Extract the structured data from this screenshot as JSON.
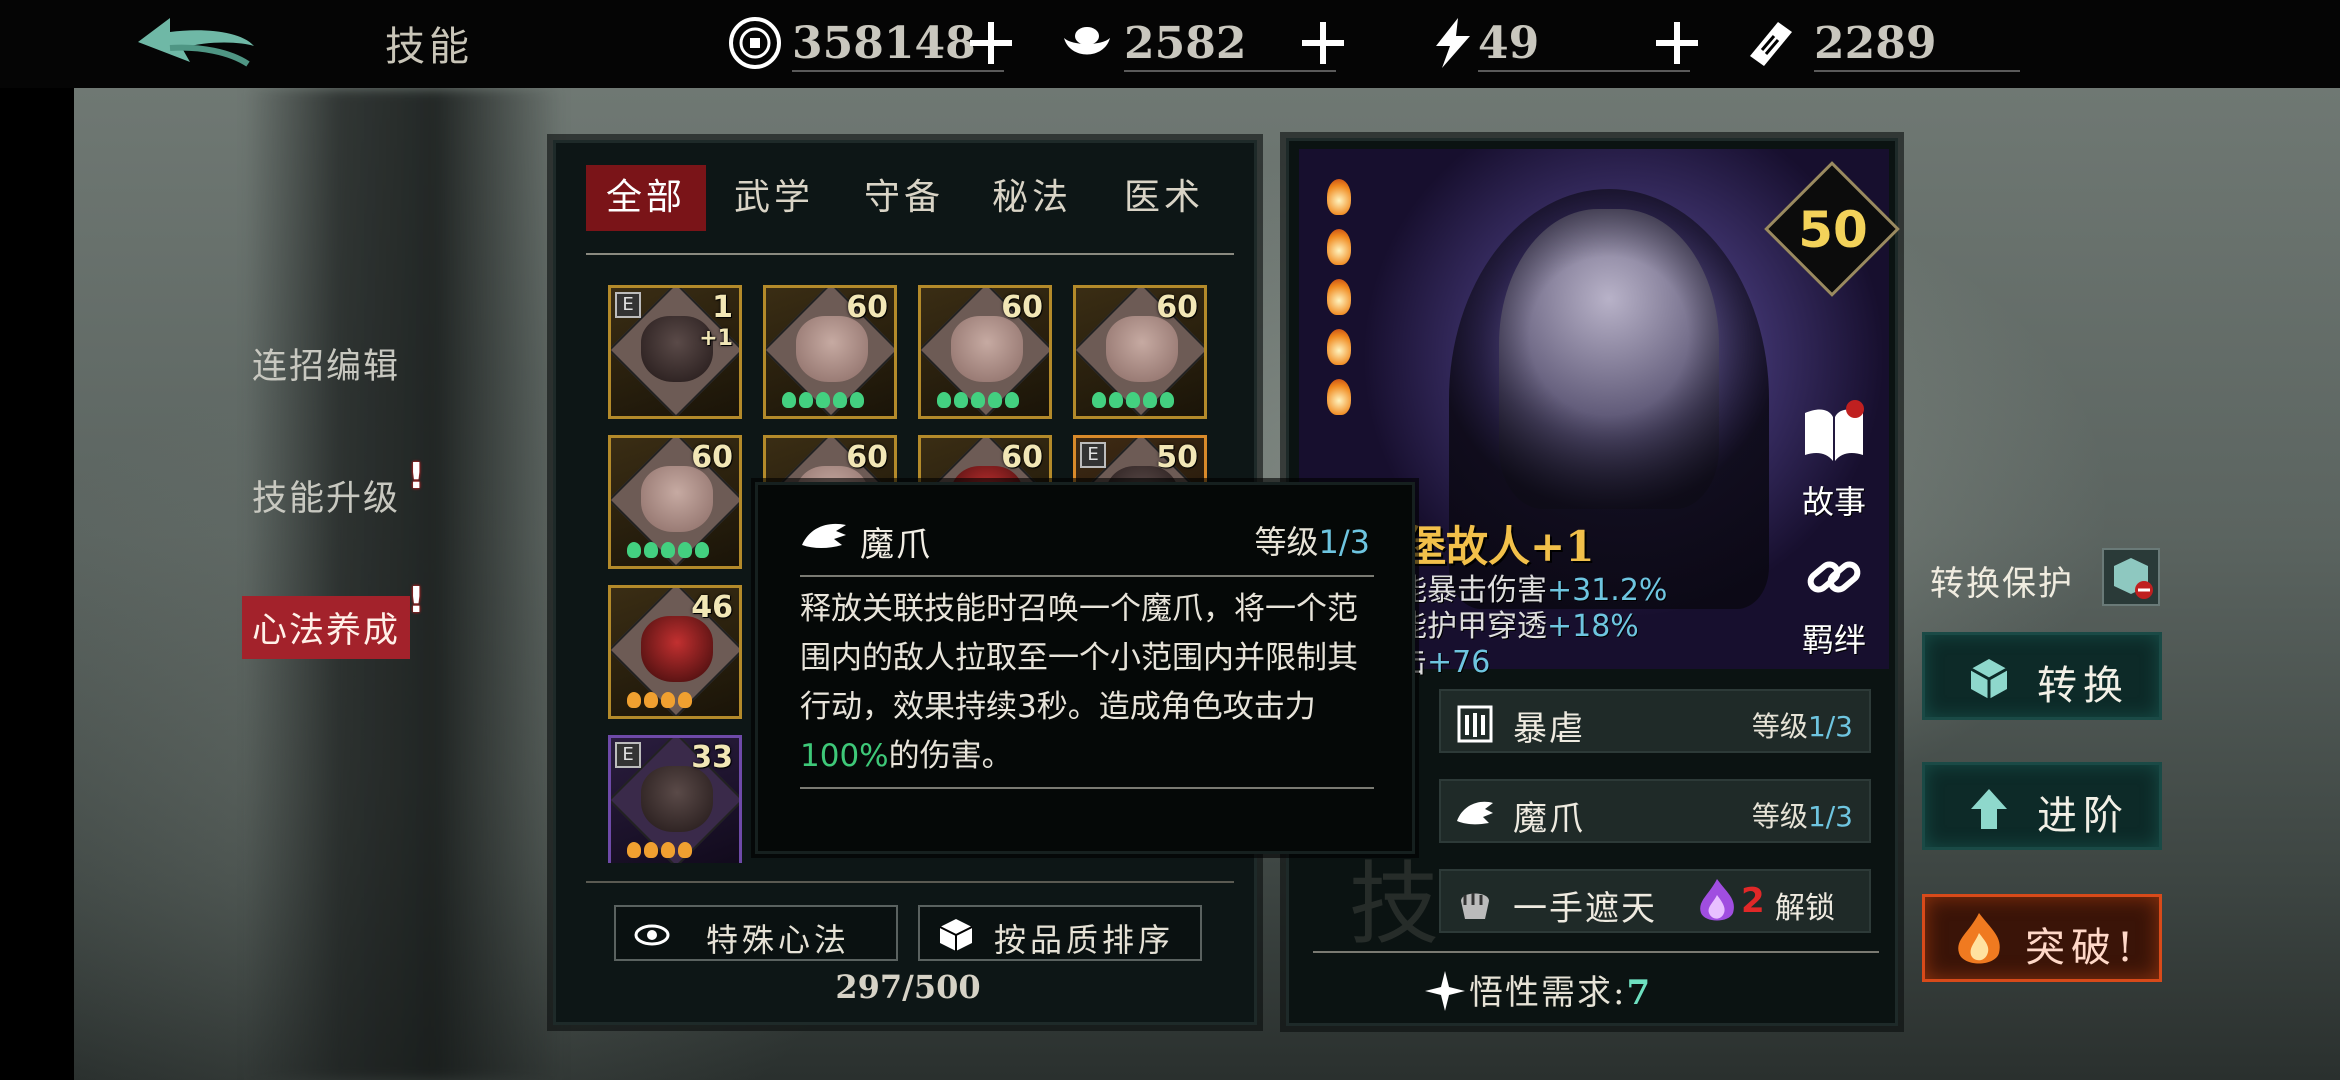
{
  "header": {
    "title": "技能",
    "currencies": [
      {
        "name": "coin-icon",
        "value": "358148"
      },
      {
        "name": "silver-ingot-icon",
        "value": "2582"
      },
      {
        "name": "lightning-icon",
        "value": "49"
      },
      {
        "name": "ticket-icon",
        "value": "2289"
      }
    ]
  },
  "left_menu": {
    "items": [
      {
        "label": "连招编辑"
      },
      {
        "label": "技能升级"
      },
      {
        "label": "心法养成"
      }
    ]
  },
  "tabs": [
    "全部",
    "武学",
    "守备",
    "秘法",
    "医术"
  ],
  "cards": [
    {
      "level": "1",
      "sub": "+1",
      "e": "E"
    },
    {
      "level": "60"
    },
    {
      "level": "60"
    },
    {
      "level": "60"
    },
    {
      "level": "60"
    },
    {
      "level": "60"
    },
    {
      "level": "60"
    },
    {
      "level": "50",
      "e": "E"
    },
    {
      "level": "46"
    },
    {
      "level": "33",
      "e": "E"
    }
  ],
  "mid_buttons": {
    "special": "特殊心法",
    "sort": "按品质排序"
  },
  "count": "297/500",
  "detail": {
    "level": "50",
    "name": "堡故人+1",
    "stats": [
      {
        "label": "能暴击伤害",
        "value": "+31.2%"
      },
      {
        "label": "能护甲穿透",
        "value": "+18%"
      },
      {
        "label": "击",
        "value": "+76"
      }
    ],
    "story_label": "故事",
    "bond_label": "羁绊",
    "skills": [
      {
        "name": "暴虐",
        "level_label": "等级",
        "level": "1/3"
      },
      {
        "name": "魔爪",
        "level_label": "等级",
        "level": "1/3"
      },
      {
        "name": "一手遮天",
        "unlock_count": "2",
        "unlock_label": "解锁"
      }
    ],
    "wuxing_label": "悟性需求:",
    "wuxing_value": "7"
  },
  "right_actions": {
    "protect_label": "转换保护",
    "convert": "转换",
    "advance": "进阶",
    "breakthrough": "突破!"
  },
  "tooltip": {
    "name": "魔爪",
    "level_label": "等级",
    "level": "1/3",
    "desc_pre": "释放关联技能时召唤一个魔爪，将一个范围内的敌人拉取至一个小范围内并限制其行动，效果持续3秒。造成角色攻击力",
    "desc_highlight": "100%",
    "desc_post": "的伤害。"
  },
  "colors": {
    "accent_red": "#a3222b",
    "highlight_blue": "#6ec5e0",
    "highlight_green": "#3ec878",
    "gold": "#f3d25a"
  }
}
